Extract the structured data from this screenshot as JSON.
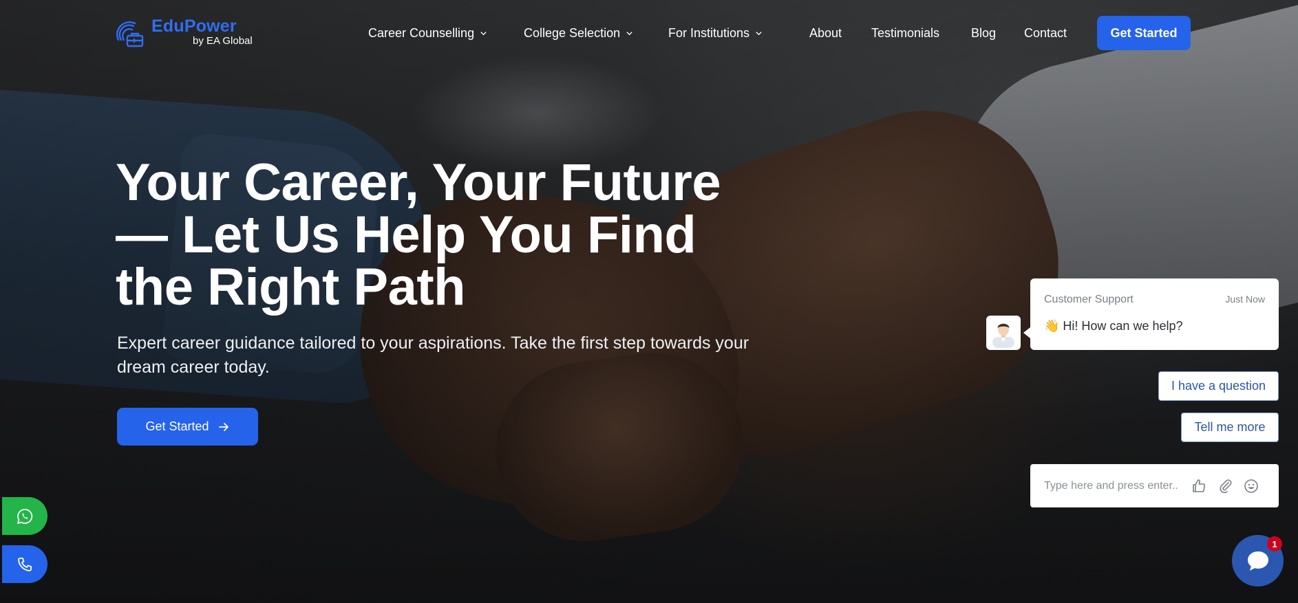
{
  "brand": {
    "name": "EduPower",
    "tagline": "by EA Global",
    "logo_icon": "compass-pencil-logo",
    "primary_color": "#2563eb"
  },
  "nav": {
    "items": [
      {
        "label": "Career Counselling",
        "has_dropdown": true
      },
      {
        "label": "College Selection",
        "has_dropdown": true
      },
      {
        "label": "For Institutions",
        "has_dropdown": true
      },
      {
        "label": "About",
        "has_dropdown": false
      },
      {
        "label": "Testimonials",
        "has_dropdown": false
      },
      {
        "label": "Blog",
        "has_dropdown": false
      },
      {
        "label": "Contact",
        "has_dropdown": false
      }
    ],
    "cta_label": "Get Started"
  },
  "hero": {
    "title": "Your Career, Your Future — Let Us Help You Find the Right Path",
    "subtitle": "Expert career guidance tailored to your aspirations. Take the first step towards your dream career today.",
    "cta_label": "Get Started",
    "cta_icon": "arrow-right-icon"
  },
  "floating_contacts": {
    "whatsapp_icon": "whatsapp-icon",
    "whatsapp_color": "#23b44a",
    "phone_icon": "phone-icon",
    "phone_color": "#2563eb"
  },
  "chat": {
    "agent_name": "Customer Support",
    "timestamp": "Just Now",
    "message": "👋 Hi! How can we help?",
    "quick_replies": [
      "I have a question",
      "Tell me more"
    ],
    "input_placeholder": "Type here and press enter..",
    "input_icons": [
      "thumbs-up-icon",
      "paperclip-icon",
      "smiley-icon"
    ],
    "launcher_icon": "chat-bubble-icon",
    "unread_count": "1",
    "launcher_color": "#2b57b0"
  }
}
